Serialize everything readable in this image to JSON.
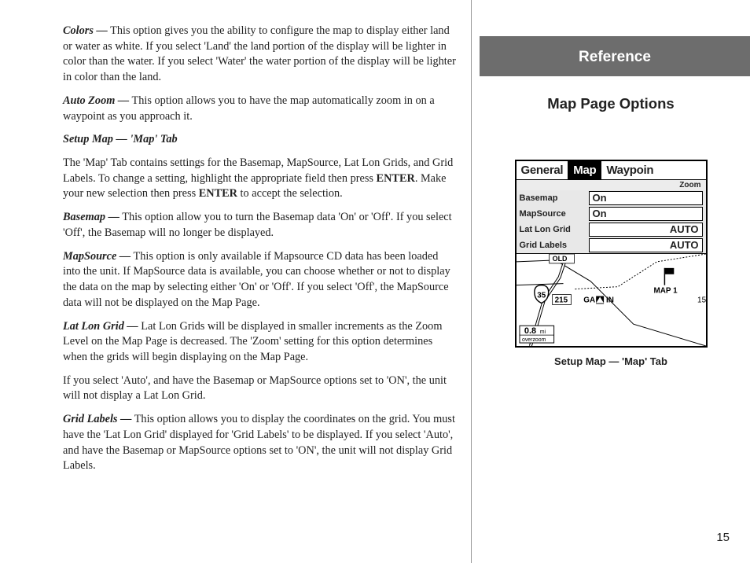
{
  "left": {
    "colors_label": "Colors —",
    "colors_body": " This option gives you the ability to configure the map to display either land or water as white.  If you select 'Land' the land portion of the display will be lighter in color than the water.  If you select 'Water' the water portion of the display will be lighter in color than the land.",
    "autozoom_label": "Auto Zoom —",
    "autozoom_body": " This option allows you to have the map automatically zoom in on a waypoint as you approach it.",
    "setupmap_subhead": " Setup Map — 'Map' Tab",
    "setupmap_p1a": "The 'Map' Tab contains settings for the Basemap, MapSource, Lat Lon Grids, and Grid Labels.  To change a setting, highlight the appropriate field then press ",
    "enter1": "ENTER",
    "setupmap_p1b": ".  Make your new selection then press ",
    "enter2": "ENTER",
    "setupmap_p1c": " to accept the selection.",
    "basemap_label": "Basemap —",
    "basemap_body": " This option allow you to turn the Basemap data 'On' or  'Off'.  If you select 'Off', the Basemap will no longer be displayed.",
    "mapsource_label": "MapSource —",
    "mapsource_body": " This option is only available if Mapsource CD data has been loaded into the unit.  If MapSource data is available, you can choose whether or not to display the data on the map by selecting either 'On' or 'Off'.  If you select 'Off',  the MapSource data will not be displayed on the Map Page.",
    "latlon_label": "Lat Lon Grid —",
    "latlon_body": " Lat Lon Grids will be displayed in smaller increments as the Zoom Level on the Map Page is decreased.  The 'Zoom' setting for this option determines when the grids will begin displaying on the Map Page.",
    "latlon_p2": "If you select 'Auto', and have the Basemap or MapSource options set to 'ON', the unit will not display a Lat Lon Grid.",
    "gridlabels_label": "Grid Labels —",
    "gridlabels_body": " This option allows you to display the coordinates on the grid.  You must have the 'Lat Lon Grid' displayed for 'Grid Labels' to be displayed. If you select 'Auto', and have the Basemap or MapSource options set to 'ON', the unit will not display Grid Labels."
  },
  "right": {
    "banner": "Reference",
    "subtitle": "Map Page Options",
    "caption": "Setup Map — 'Map' Tab",
    "page_num": "15"
  },
  "device": {
    "tabs": {
      "general": "General",
      "map": "Map",
      "waypoint": "Waypoin"
    },
    "zoom_header": "Zoom",
    "rows": {
      "basemap": {
        "label": "Basemap",
        "value": "On"
      },
      "mapsource": {
        "label": "MapSource",
        "value": "On"
      },
      "latlon": {
        "label": "Lat Lon Grid",
        "value": "AUTO"
      },
      "gridlabels": {
        "label": "Grid Labels",
        "value": "AUTO"
      }
    },
    "map": {
      "old": "OLD",
      "highway": "35",
      "exit": "215",
      "map1": "MAP 1",
      "brand": "GARMIN",
      "scale_left": "0.8",
      "scale_unit": "mi",
      "scale_right": "15",
      "overzoom": "overzoom"
    }
  }
}
